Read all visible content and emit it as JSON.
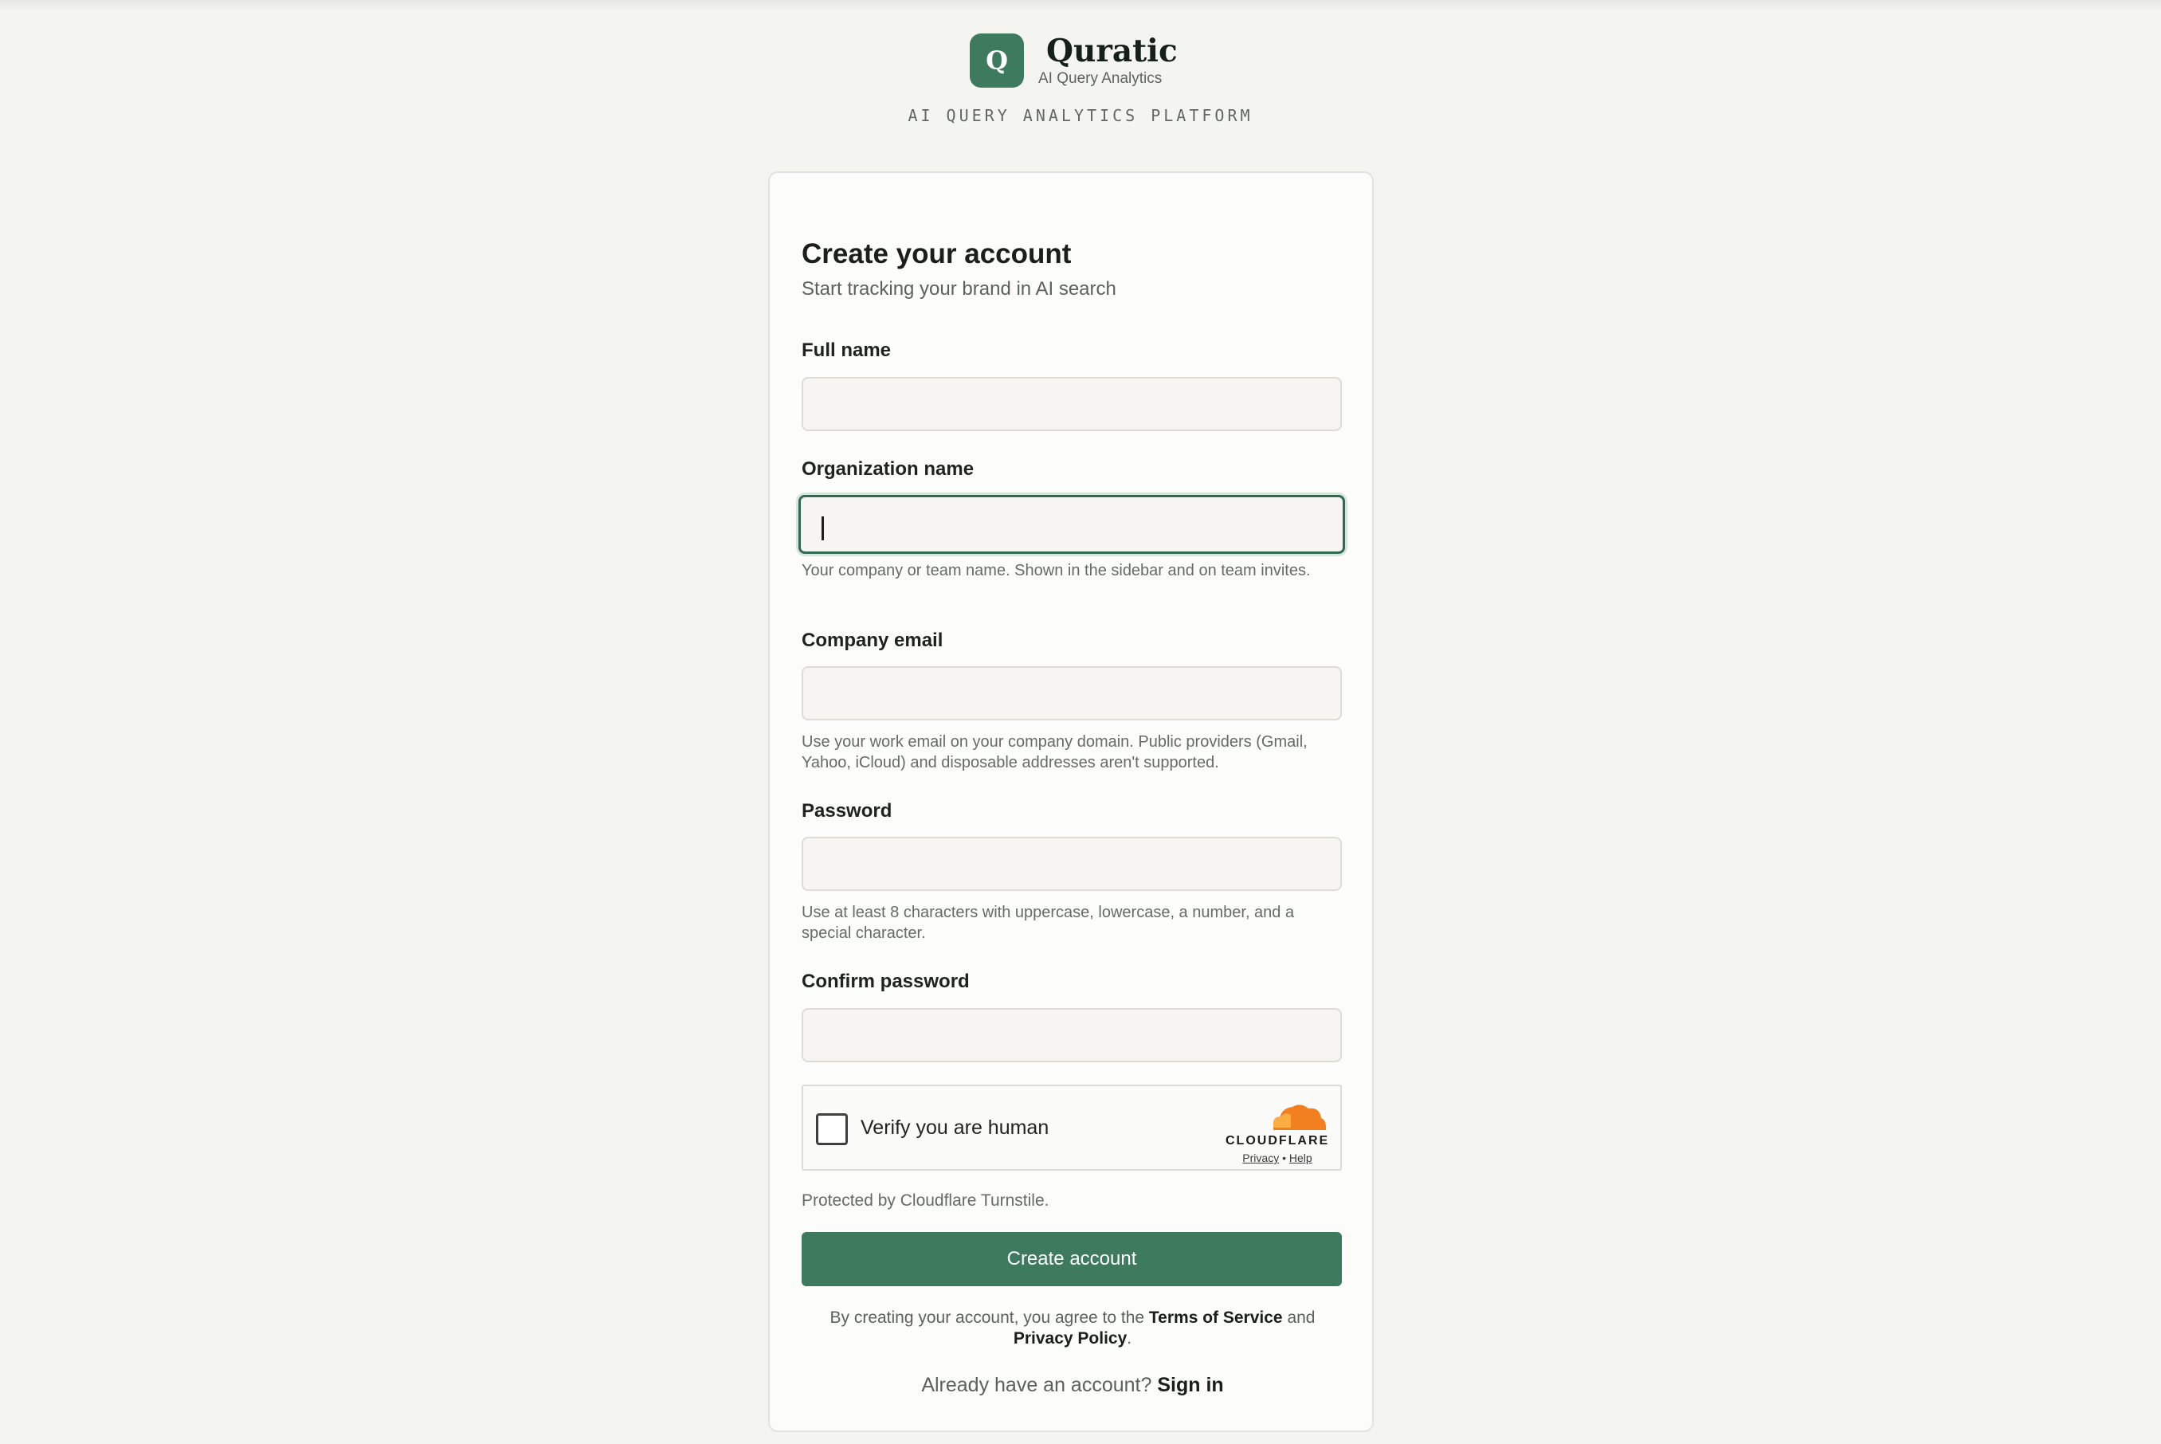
{
  "brand": {
    "logo_letter": "Q",
    "name": "Quratic",
    "tagline": "AI Query Analytics",
    "platform": "AI QUERY ANALYTICS PLATFORM"
  },
  "form": {
    "title": "Create your account",
    "subtitle": "Start tracking your brand in AI search",
    "full_name": {
      "label": "Full name",
      "value": "",
      "placeholder": ""
    },
    "organization": {
      "label": "Organization name",
      "value": "",
      "placeholder": "",
      "help": "Your company or team name. Shown in the sidebar and on team invites."
    },
    "email": {
      "label": "Company email",
      "value": "",
      "placeholder": "",
      "help": "Use your work email on your company domain. Public providers (Gmail, Yahoo, iCloud) and disposable addresses aren't supported."
    },
    "password": {
      "label": "Password",
      "value": "",
      "placeholder": "",
      "help": "Use at least 8 characters with uppercase, lowercase, a number, and a special character."
    },
    "confirm_password": {
      "label": "Confirm password",
      "value": "",
      "placeholder": ""
    },
    "turnstile": {
      "label": "Verify you are human",
      "brand": "CLOUDFLARE",
      "privacy": "Privacy",
      "separator": "•",
      "help": "Help"
    },
    "protected": "Protected by Cloudflare Turnstile.",
    "submit": "Create account",
    "terms": {
      "prefix": "By creating your account, you agree to the",
      "tos": "Terms of Service",
      "and": "and",
      "privacy": "Privacy Policy",
      "suffix": "."
    },
    "signin": {
      "prompt": "Already have an account?",
      "link": "Sign in"
    }
  },
  "colors": {
    "accent": "#3d7a5e",
    "background": "#f4f4f0",
    "cloudflare_orange": "#f38020"
  }
}
